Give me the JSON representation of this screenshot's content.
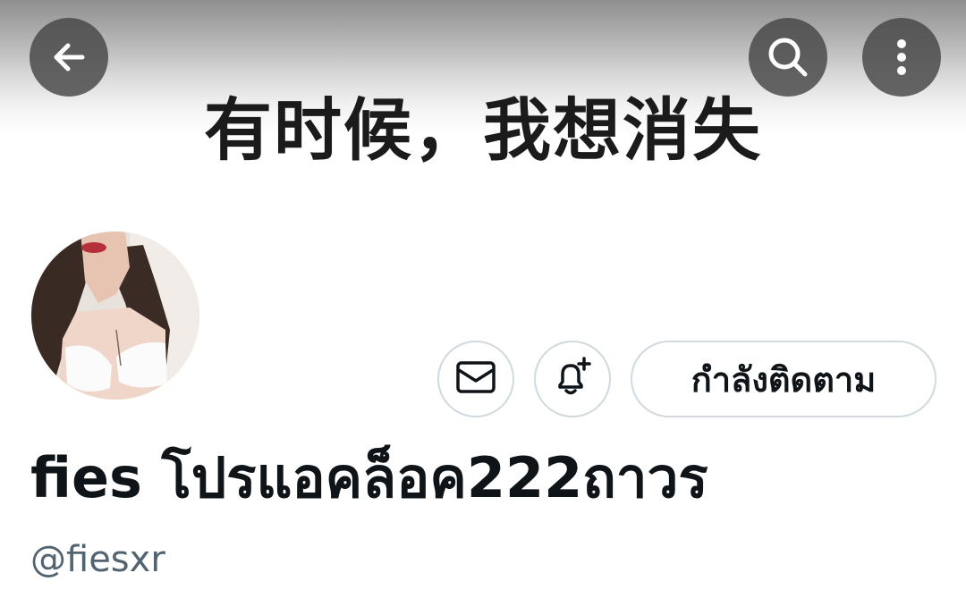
{
  "banner": {
    "text": "有时候，我想消失"
  },
  "top_bar": {
    "back_icon": "arrow-left-icon",
    "search_icon": "search-icon",
    "more_icon": "more-vertical-icon"
  },
  "profile": {
    "avatar_icon": "avatar-photo",
    "display_name": "fies โปรแอคล็อค222ถาวร",
    "handle": "@fiesxr"
  },
  "actions": {
    "message_icon": "mail-icon",
    "notify_icon": "bell-plus-icon",
    "follow_label": "กำลังติดตาม"
  },
  "colors": {
    "text_primary": "#0f1419",
    "text_secondary": "#536471",
    "button_border": "#cfd9de",
    "overlay_button": "#464646"
  }
}
